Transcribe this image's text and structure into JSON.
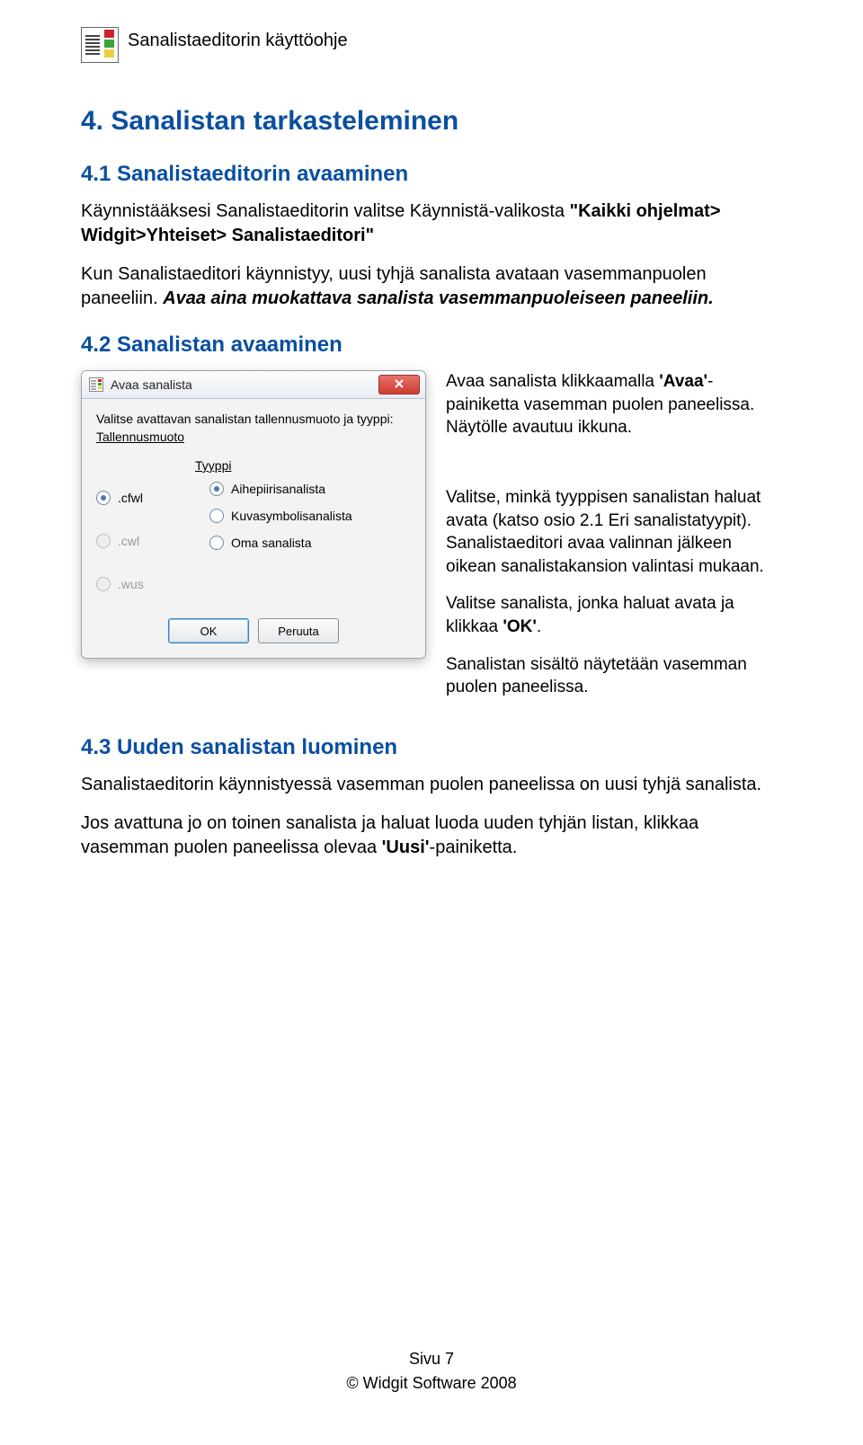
{
  "header": {
    "title": "Sanalistaeditorin käyttöohje"
  },
  "section4": {
    "title": "4. Sanalistan tarkasteleminen",
    "s41": {
      "title": "4.1 Sanalistaeditorin avaaminen",
      "p1_a": "Käynnistääksesi Sanalistaeditorin valitse Käynnistä-valikosta ",
      "p1_b": "\"Kaikki ohjelmat> Widgit>Yhteiset> Sanalistaeditori\"",
      "p2_a": "Kun Sanalistaeditori käynnistyy, uusi tyhjä sanalista avataan vasemmanpuolen paneeliin. ",
      "p2_b": "Avaa aina muokattava sanalista vasemmanpuoleiseen paneeliin."
    },
    "s42": {
      "title": "4.2 Sanalistan avaaminen",
      "right_p1_a": "Avaa sanalista klikkaamalla ",
      "right_p1_b": "'Avaa'",
      "right_p1_c": "-painiketta vasemman puolen paneelissa. Näytölle avautuu ikkuna.",
      "right_p2": "Valitse, minkä tyyppisen sanalistan haluat avata (katso osio 2.1 Eri sanalistatyypit). Sanalistaeditori avaa valinnan jälkeen oikean sanalistakansion valintasi mukaan.",
      "right_p3_a": "Valitse sanalista, jonka haluat avata ja klikkaa ",
      "right_p3_b": "'OK'",
      "right_p3_c": ".",
      "right_p4": "Sanalistan sisältö näytetään vasemman puolen paneelissa."
    },
    "s43": {
      "title": "4.3 Uuden sanalistan luominen",
      "p1": "Sanalistaeditorin käynnistyessä vasemman puolen paneelissa on uusi tyhjä sanalista.",
      "p2_a": "Jos avattuna jo on toinen sanalista ja haluat luoda uuden tyhjän listan, klikkaa vasemman puolen paneelissa olevaa ",
      "p2_b": "'Uusi'",
      "p2_c": "-painiketta."
    }
  },
  "dialog": {
    "title": "Avaa sanalista",
    "prompt": "Valitse avattavan sanalistan tallennusmuoto ja tyyppi:",
    "subtitle": "Tallennusmuoto",
    "type_label": "Tyyppi",
    "left_opts": [
      {
        "label": ".cfwl",
        "checked": true,
        "disabled": false
      },
      {
        "label": ".cwl",
        "checked": false,
        "disabled": true
      },
      {
        "label": ".wus",
        "checked": false,
        "disabled": true
      }
    ],
    "type_opts": [
      {
        "label": "Aihepiirisanalista",
        "checked": true
      },
      {
        "label": "Kuvasymbolisanalista",
        "checked": false
      },
      {
        "label": "Oma sanalista",
        "checked": false
      }
    ],
    "ok": "OK",
    "cancel": "Peruuta"
  },
  "footer": {
    "page": "Sivu 7",
    "copyright": "© Widgit Software 2008"
  }
}
